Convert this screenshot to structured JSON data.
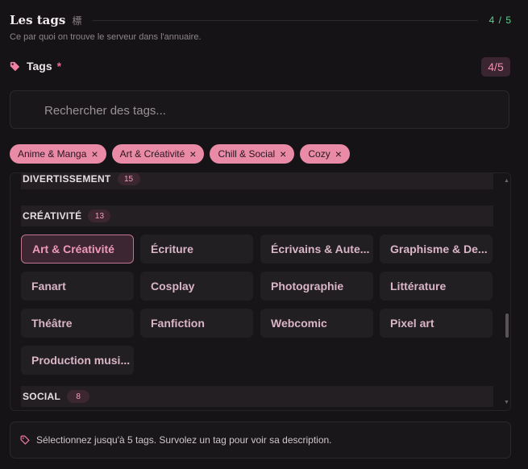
{
  "header": {
    "title": "Les tags",
    "badge_glyph": "標",
    "count": "4 / 5",
    "subtitle": "Ce par quoi on trouve le serveur dans l'annuaire."
  },
  "tags_field": {
    "label": "Tags",
    "required_mark": "*",
    "count": "4/5",
    "icon": "tag-icon"
  },
  "search": {
    "placeholder": "Rechercher des tags..."
  },
  "selected": [
    {
      "label": "Anime & Manga",
      "remove": "×"
    },
    {
      "label": "Art & Créativité",
      "remove": "×"
    },
    {
      "label": "Chill & Social",
      "remove": "×"
    },
    {
      "label": "Cozy",
      "remove": "×"
    }
  ],
  "categories": [
    {
      "name": "DIVERTISSEMENT",
      "count": "15"
    },
    {
      "name": "CRÉATIVITÉ",
      "count": "13"
    },
    {
      "name": "SOCIAL",
      "count": "8"
    }
  ],
  "creativity_tags": [
    "Art & Créativité",
    "Écriture",
    "Écrivains & Auteurs",
    "Graphisme & Design",
    "Fanart",
    "Cosplay",
    "Photographie",
    "Littérature",
    "Théâtre",
    "Fanfiction",
    "Webcomic",
    "Pixel art",
    "Production musicale"
  ],
  "selected_tag": "Art & Créativité",
  "info": {
    "text": "Sélectionnez jusqu'à 5 tags. Survolez un tag pour voir sa description.",
    "icon": "tag-icon"
  },
  "colors": {
    "accent": "#e98aa6",
    "count_green": "#5fcf8e",
    "background": "#161316"
  }
}
